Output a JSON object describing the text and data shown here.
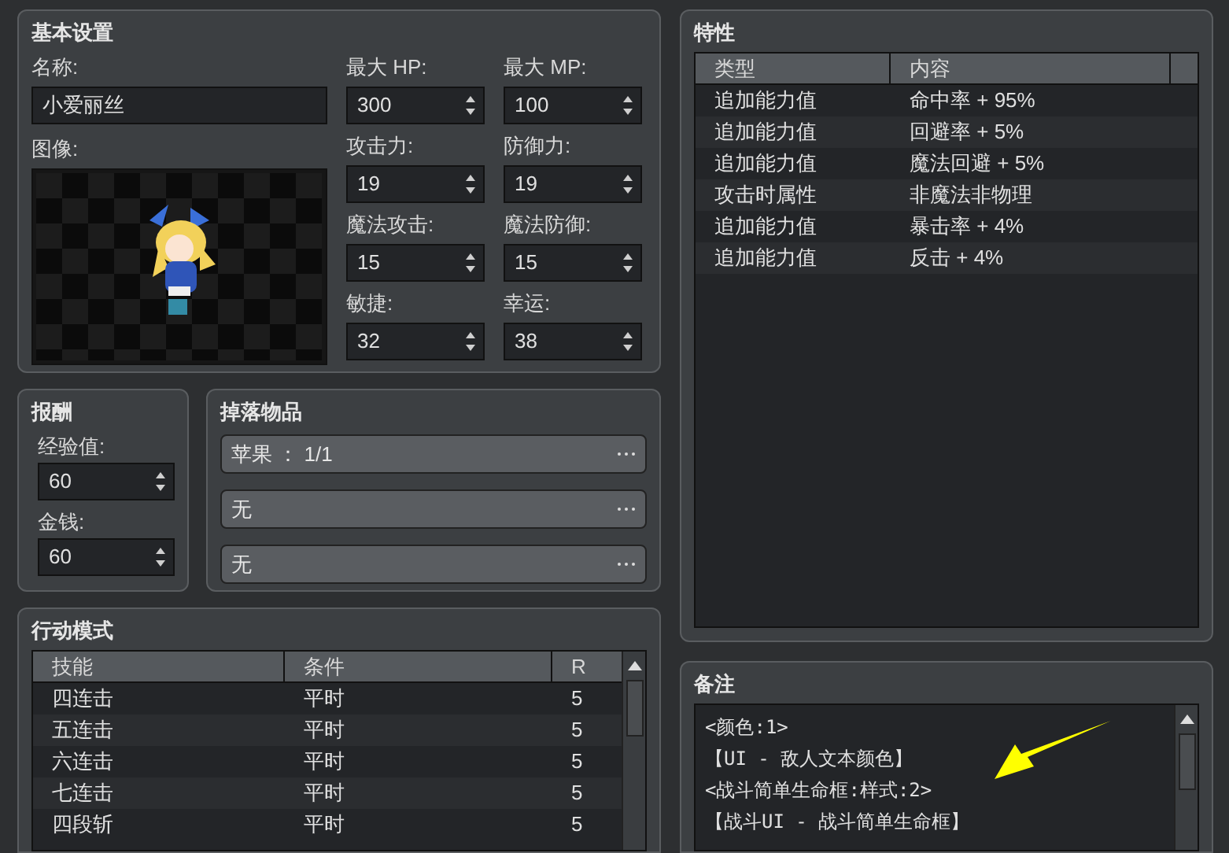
{
  "basic": {
    "title": "基本设置",
    "name_label": "名称:",
    "name_value": "小爱丽丝",
    "image_label": "图像:",
    "stats": [
      {
        "label": "最大 HP:",
        "value": "300"
      },
      {
        "label": "最大 MP:",
        "value": "100"
      },
      {
        "label": "攻击力:",
        "value": "19"
      },
      {
        "label": "防御力:",
        "value": "19"
      },
      {
        "label": "魔法攻击:",
        "value": "15"
      },
      {
        "label": "魔法防御:",
        "value": "15"
      },
      {
        "label": "敏捷:",
        "value": "32"
      },
      {
        "label": "幸运:",
        "value": "38"
      }
    ]
  },
  "rewards": {
    "title": "报酬",
    "fields": [
      {
        "label": "经验值:",
        "value": "60"
      },
      {
        "label": "金钱:",
        "value": "60"
      }
    ]
  },
  "drops": {
    "title": "掉落物品",
    "items": [
      "苹果 ： 1/1",
      "无",
      "无"
    ]
  },
  "actions": {
    "title": "行动模式",
    "columns": [
      "技能",
      "条件",
      "R"
    ],
    "rows": [
      {
        "skill": "四连击",
        "condition": "平时",
        "rating": "5"
      },
      {
        "skill": "五连击",
        "condition": "平时",
        "rating": "5"
      },
      {
        "skill": "六连击",
        "condition": "平时",
        "rating": "5"
      },
      {
        "skill": "七连击",
        "condition": "平时",
        "rating": "5"
      },
      {
        "skill": "四段斩",
        "condition": "平时",
        "rating": "5"
      }
    ]
  },
  "traits": {
    "title": "特性",
    "columns": [
      "类型",
      "内容"
    ],
    "rows": [
      {
        "type": "追加能力值",
        "content": "命中率 + 95%"
      },
      {
        "type": "追加能力值",
        "content": "回避率 + 5%"
      },
      {
        "type": "追加能力值",
        "content": "魔法回避 + 5%"
      },
      {
        "type": "攻击时属性",
        "content": "非魔法非物理"
      },
      {
        "type": "追加能力值",
        "content": "暴击率 + 4%"
      },
      {
        "type": "追加能力值",
        "content": "反击 + 4%"
      }
    ]
  },
  "note": {
    "title": "备注",
    "lines": [
      "<颜色:1>",
      "【UI - 敌人文本颜色】",
      "<战斗简单生命框:样式:2>",
      "【战斗UI - 战斗简单生命框】"
    ]
  }
}
